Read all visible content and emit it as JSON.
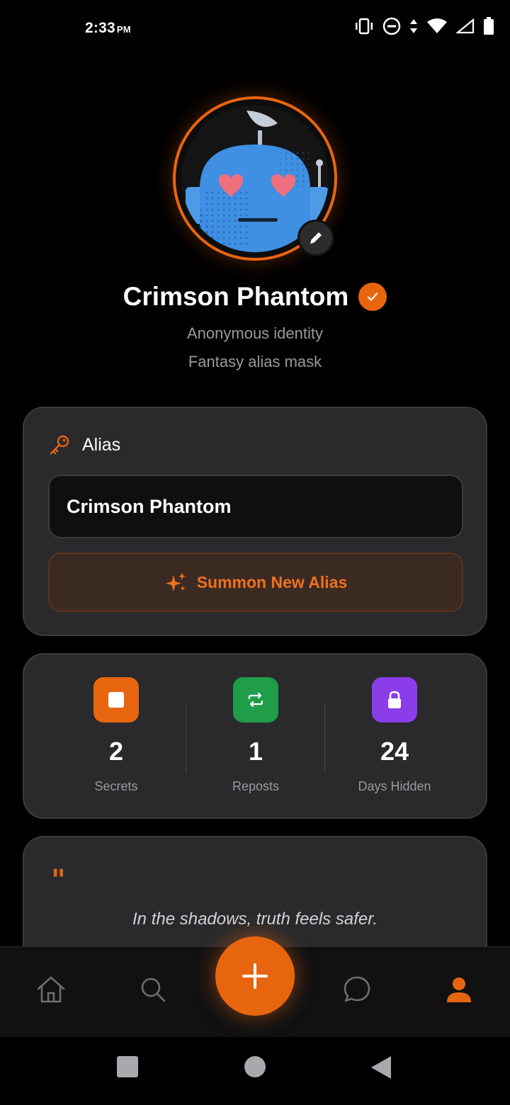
{
  "status_bar": {
    "time": "2:33",
    "ampm": "PM"
  },
  "profile": {
    "name": "Crimson Phantom",
    "subtitle_1": "Anonymous identity",
    "subtitle_2": "Fantasy alias mask",
    "avatar_icon": "robot-avatar-icon"
  },
  "alias_card": {
    "header_label": "Alias",
    "field_value": "Crimson Phantom",
    "summon_label": "Summon New Alias"
  },
  "stats": [
    {
      "value": "2",
      "label": "Secrets",
      "color": "#e8650f",
      "icon": "square-icon"
    },
    {
      "value": "1",
      "label": "Reposts",
      "color": "#1f9d48",
      "icon": "repost-icon"
    },
    {
      "value": "24",
      "label": "Days Hidden",
      "color": "#8b3dea",
      "icon": "lock-icon"
    }
  ],
  "quote": {
    "mark": "\"",
    "text": "In the shadows, truth feels safer."
  },
  "bottom_nav": [
    "home-icon",
    "search-icon",
    "add-icon",
    "chat-icon",
    "profile-icon"
  ],
  "colors": {
    "accent": "#e8650f",
    "card_bg": "#2a2a2c",
    "background": "#000000"
  }
}
